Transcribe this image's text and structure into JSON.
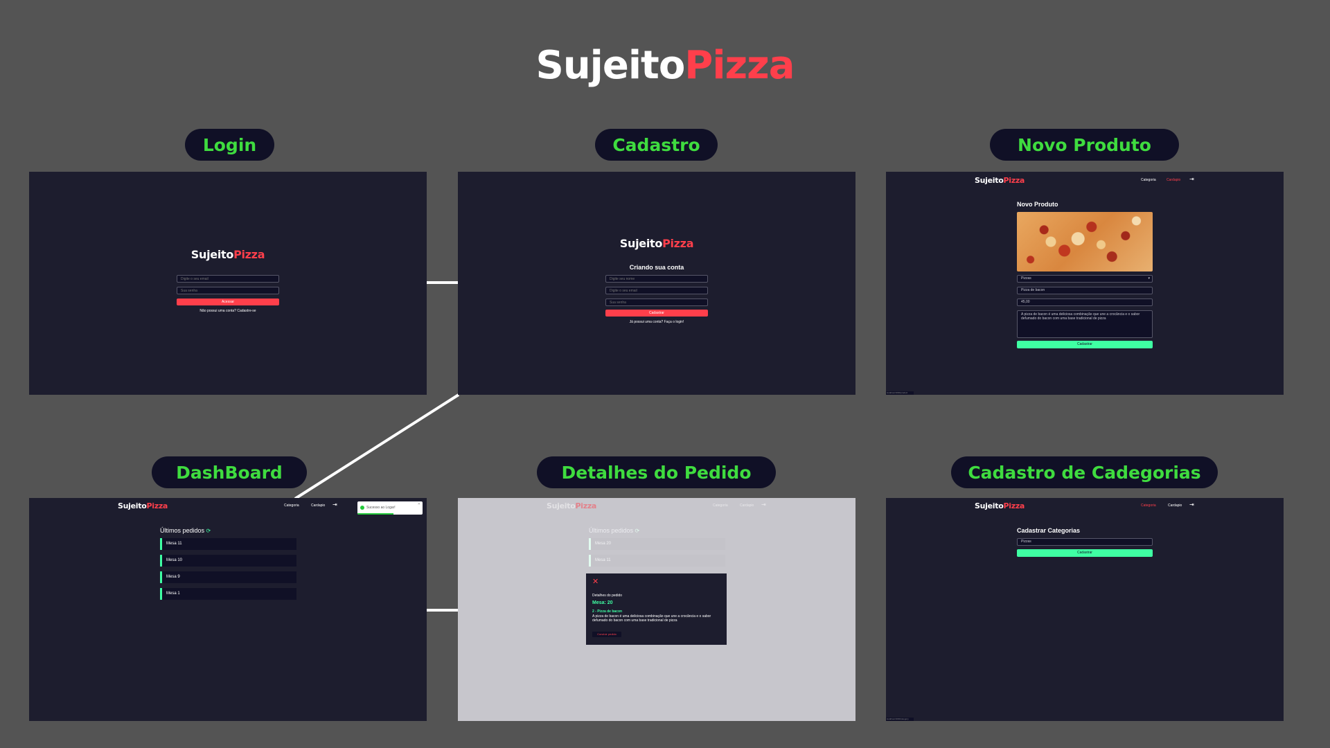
{
  "brand": {
    "first": "Sujeito",
    "second": "Pizza"
  },
  "colors": {
    "background": "#545454",
    "screen_bg": "#1d1d2e",
    "input_bg": "#101026",
    "accent_red": "#ff3f4b",
    "accent_green": "#3fffa3",
    "label_green": "#3fdc3f"
  },
  "labels": {
    "login": "Login",
    "cadastro": "Cadastro",
    "novo_produto": "Novo Produto",
    "dashboard": "DashBoard",
    "detalhes": "Detalhes do Pedido",
    "categorias": "Cadastro de Cadegorias"
  },
  "login": {
    "email_placeholder": "Digite o seu email",
    "password_placeholder": "Sua senha",
    "submit": "Acessar",
    "link": "Não possui uma conta? Cadastre-se"
  },
  "signup": {
    "title": "Criando sua conta",
    "name_placeholder": "Digite seu nome",
    "email_placeholder": "Digite o seu email",
    "password_placeholder": "Sua senha",
    "submit": "Cadastrar",
    "link": "Já possui uma conta? Faça o login!"
  },
  "nav": {
    "category": "Categoria",
    "menu": "Cardapio",
    "logout_icon": "logout-icon"
  },
  "product": {
    "title": "Novo Produto",
    "category_value": "Pizzas",
    "name_value": "Pizza de bacon",
    "price_value": "45,00",
    "description_value": "A pizza de bacon é uma deliciosa combinação que une a crocância e o sabor defumado do bacon com uma base tradicional de pizza",
    "submit": "Cadastrar",
    "footer_tag": "localhost:3000/product"
  },
  "dashboard": {
    "title": "Últimos pedidos",
    "toast": "Sucesso ao Logar!",
    "orders": [
      "Mesa 11",
      "Mesa 10",
      "Mesa 9",
      "Mesa 1"
    ]
  },
  "details": {
    "title": "Últimos pedidos",
    "orders": [
      "Mesa 20",
      "Mesa 11"
    ],
    "modal": {
      "heading": "Detalhes do pedido",
      "table": "Mesa: 20",
      "item": "2 - Pizza de bacon",
      "description": "A pizza de bacon é uma deliciosa combinação que une a crocância e o sabor defumado do bacon com uma base tradicional de pizza",
      "finish": "Concluir pedido"
    }
  },
  "category": {
    "title": "Cadastrar Categorias",
    "input_value": "Pizzas",
    "submit": "Cadastrar",
    "footer_tag": "localhost:3000/category"
  }
}
